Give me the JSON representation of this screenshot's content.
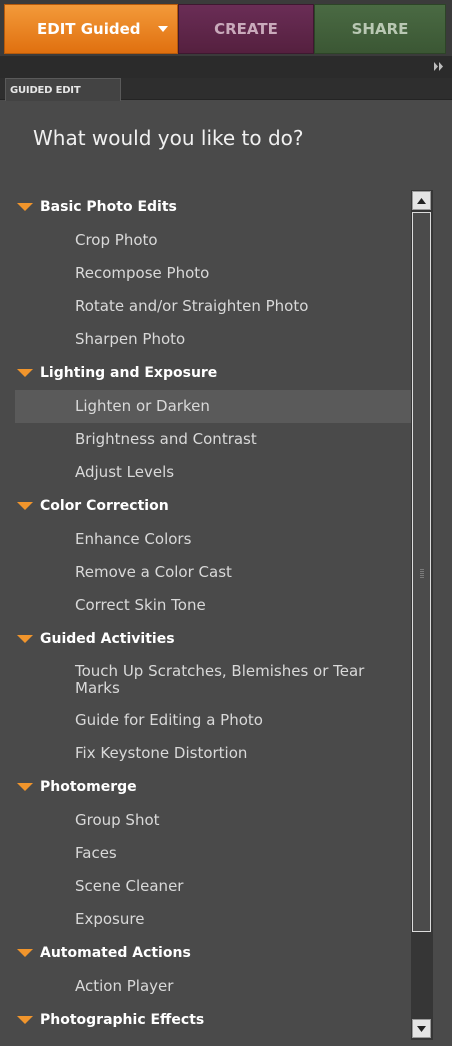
{
  "tabs": {
    "edit_label": "EDIT Guided",
    "create_label": "CREATE",
    "share_label": "SHARE"
  },
  "panel": {
    "tab_label": "GUIDED EDIT",
    "question": "What would you like to do?"
  },
  "groups": [
    {
      "title": "Basic Photo Edits",
      "items": [
        "Crop Photo",
        "Recompose Photo",
        "Rotate and/or Straighten Photo",
        "Sharpen Photo"
      ]
    },
    {
      "title": "Lighting and Exposure",
      "items": [
        "Lighten or Darken",
        "Brightness and Contrast",
        "Adjust Levels"
      ]
    },
    {
      "title": "Color Correction",
      "items": [
        "Enhance Colors",
        "Remove a Color Cast",
        "Correct Skin Tone"
      ]
    },
    {
      "title": "Guided Activities",
      "items": [
        "Touch Up Scratches, Blemishes or Tear Marks",
        "Guide for Editing a Photo",
        "Fix Keystone Distortion"
      ]
    },
    {
      "title": "Photomerge",
      "items": [
        "Group Shot",
        "Faces",
        "Scene Cleaner",
        "Exposure"
      ]
    },
    {
      "title": "Automated Actions",
      "items": [
        "Action Player"
      ]
    },
    {
      "title": "Photographic Effects",
      "items": []
    }
  ],
  "selected_item": "Lighten or Darken",
  "colors": {
    "accent_orange": "#e0700f",
    "create_purple": "#55203f",
    "share_green": "#3b5734",
    "panel_bg": "#4a4a4a"
  }
}
